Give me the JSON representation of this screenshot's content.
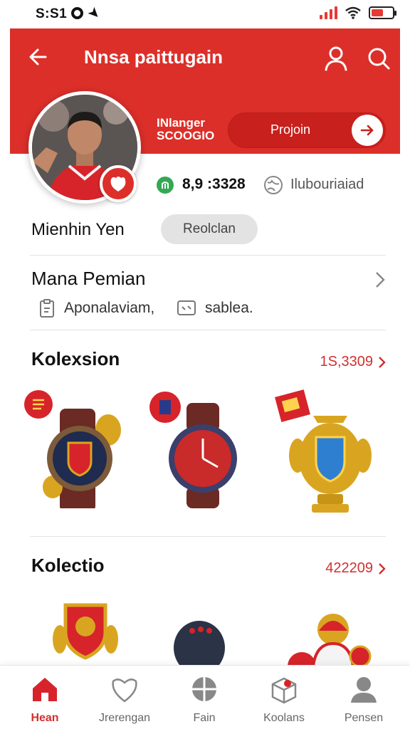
{
  "status": {
    "time": "S:S1"
  },
  "header": {
    "title": "Nnsa paittugain",
    "badge_line1": "INlanger",
    "badge_line2": "SCOOGIO",
    "action_label": "Projoin"
  },
  "profile": {
    "coins": "8,9 :3328",
    "region_label": "Ilubouriaiad",
    "name": "Mienhin Yen",
    "role_chip": "Reolclan"
  },
  "details": {
    "title": "Mana Pemian",
    "meta": [
      {
        "icon": "document-icon",
        "label": "Aponalaviam,"
      },
      {
        "icon": "chat-icon",
        "label": "sablea."
      }
    ]
  },
  "collections": [
    {
      "title": "Kolexsion",
      "count": "1S,3309",
      "items": [
        {
          "icon": "watch-icon"
        },
        {
          "icon": "watch-icon"
        },
        {
          "icon": "trophy-icon"
        }
      ]
    },
    {
      "title": "Kolectio",
      "count": "422209",
      "items": [
        {
          "icon": "mascot-icon"
        },
        {
          "icon": "ball-icon"
        },
        {
          "icon": "mascot-icon"
        }
      ]
    }
  ],
  "colors": {
    "accent": "#dc2f2a",
    "pill": "#c8201d",
    "gold": "#d9a521",
    "coin": "#34a853"
  },
  "nav": [
    {
      "label": "Hean",
      "icon": "home-icon",
      "active": true
    },
    {
      "label": "Jrerengan",
      "icon": "heart-icon",
      "active": false
    },
    {
      "label": "Fain",
      "icon": "ball-icon",
      "active": false
    },
    {
      "label": "Koolans",
      "icon": "box-icon",
      "active": false
    },
    {
      "label": "Pensen",
      "icon": "person-icon",
      "active": false
    }
  ]
}
